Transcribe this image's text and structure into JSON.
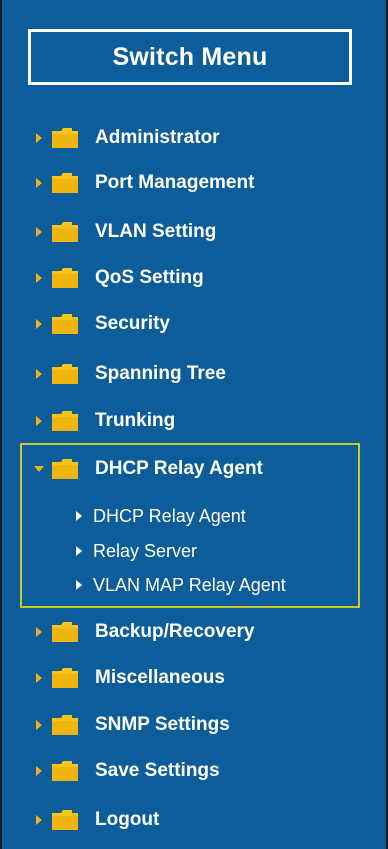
{
  "title": "Switch Menu",
  "colors": {
    "background": "#0d5d9b",
    "folder": "#f7c515",
    "arrow": "#f2b117",
    "highlight_border": "#c8cb2b",
    "text": "#ffffff"
  },
  "menu": {
    "items": [
      {
        "label": "Administrator",
        "icon": "folder-icon",
        "state": "collapsed"
      },
      {
        "label": "Port Management",
        "icon": "folder-icon",
        "state": "collapsed"
      },
      {
        "label": "VLAN Setting",
        "icon": "folder-icon",
        "state": "collapsed"
      },
      {
        "label": "QoS Setting",
        "icon": "folder-icon",
        "state": "collapsed"
      },
      {
        "label": "Security",
        "icon": "folder-icon",
        "state": "collapsed"
      },
      {
        "label": "Spanning Tree",
        "icon": "folder-icon",
        "state": "collapsed"
      },
      {
        "label": "Trunking",
        "icon": "folder-icon",
        "state": "collapsed"
      },
      {
        "label": "DHCP Relay Agent",
        "icon": "folder-icon",
        "state": "expanded"
      },
      {
        "label": "Backup/Recovery",
        "icon": "folder-icon",
        "state": "collapsed"
      },
      {
        "label": "Miscellaneous",
        "icon": "folder-icon",
        "state": "collapsed"
      },
      {
        "label": "SNMP Settings",
        "icon": "folder-icon",
        "state": "collapsed"
      },
      {
        "label": "Save Settings",
        "icon": "folder-icon",
        "state": "collapsed"
      },
      {
        "label": "Logout",
        "icon": "folder-icon",
        "state": "collapsed"
      }
    ],
    "dhcp_sub_items": [
      {
        "label": "DHCP Relay Agent"
      },
      {
        "label": "Relay Server"
      },
      {
        "label": "VLAN MAP Relay Agent"
      }
    ]
  }
}
